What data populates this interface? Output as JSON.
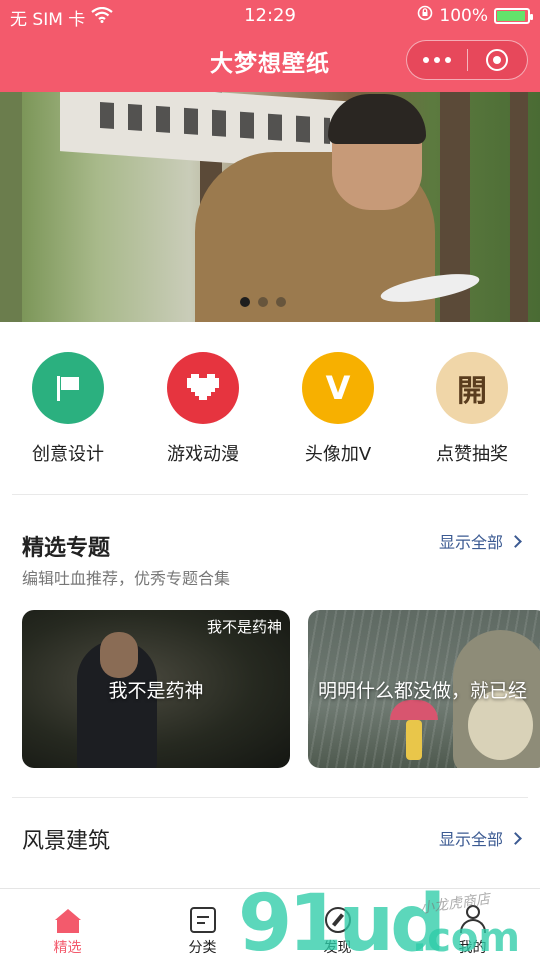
{
  "status_bar": {
    "carrier": "无 SIM 卡",
    "time": "12:29",
    "battery": "100%",
    "battery_level": 1.0
  },
  "nav": {
    "title": "大梦想壁纸"
  },
  "banner": {
    "dot_count": 3,
    "active_dot": 0
  },
  "quick_links": [
    {
      "label": "创意设计",
      "icon": "flag-icon",
      "color": "#2bb07f"
    },
    {
      "label": "游戏动漫",
      "icon": "heart-icon",
      "color": "#e6343f"
    },
    {
      "label": "头像加V",
      "icon": "v-icon",
      "glyph": "V",
      "color": "#f7b000"
    },
    {
      "label": "点赞抽奖",
      "icon": "open-icon",
      "glyph": "開",
      "color": "#f0d6a8"
    }
  ],
  "featured": {
    "title": "精选专题",
    "subtitle": "编辑吐血推荐，优秀专题合集",
    "more": "显示全部",
    "cards": [
      {
        "title": "我不是药神",
        "logo": "我不是药神"
      },
      {
        "title": "明明什么都没做，就已经"
      }
    ]
  },
  "scenery": {
    "title": "风景建筑",
    "more": "显示全部"
  },
  "tabs": [
    {
      "label": "精选",
      "icon": "home-icon",
      "active": true
    },
    {
      "label": "分类",
      "icon": "list-icon",
      "active": false
    },
    {
      "label": "发现",
      "icon": "compass-icon",
      "active": false
    },
    {
      "label": "我的",
      "icon": "user-icon",
      "active": false
    }
  ],
  "watermark": {
    "text": "91ud",
    "suffix": ".com",
    "tag": "小龙虎商店"
  },
  "colors": {
    "brand": "#f35a6c",
    "link": "#3b5a92"
  }
}
